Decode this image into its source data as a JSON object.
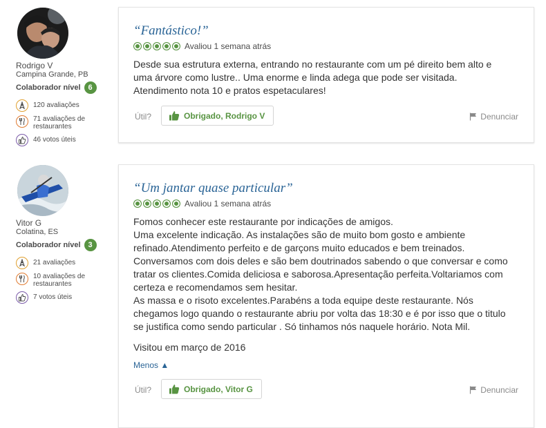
{
  "reviews": [
    {
      "member": {
        "username": "Rodrigo V",
        "location": "Campina Grande, PB",
        "level_label": "Colaborador nível",
        "level": "6",
        "stats": {
          "reviews": "120 avaliações",
          "restaurant_reviews_line1": "71 avaliações de",
          "restaurant_reviews_line2": "restaurantes",
          "helpful_votes": "46 votos úteis"
        }
      },
      "title": "“Fantástico!”",
      "rating": 5,
      "rating_date": "Avaliou 1 semana atrás",
      "body_lines": [
        "Desde sua estrutura externa, entrando no restaurante com um pé direito bem alto e",
        "uma árvore como lustre.. Uma enorme e linda adega que pode ser visitada.",
        "Atendimento nota 10 e pratos espetaculares!"
      ],
      "helpful_label": "Útil?",
      "thanks_button": "Obrigado, Rodrigo V",
      "report_label": "Denunciar"
    },
    {
      "member": {
        "username": "Vitor G",
        "location": "Colatina, ES",
        "level_label": "Colaborador nível",
        "level": "3",
        "stats": {
          "reviews": "21 avaliações",
          "restaurant_reviews_line1": "10 avaliações de",
          "restaurant_reviews_line2": "restaurantes",
          "helpful_votes": "7 votos úteis"
        }
      },
      "title": "“Um jantar quase particular”",
      "rating": 5,
      "rating_date": "Avaliou 1 semana atrás",
      "body_lines": [
        "Fomos conhecer este restaurante por indicações de amigos.",
        "Uma excelente indicação. As instalações são de muito bom gosto e ambiente",
        "refinado.Atendimento perfeito e de garçons muito educados e bem treinados.",
        "Conversamos com dois deles e são bem doutrinados sabendo o que conversar e como",
        "tratar os clientes.Comida deliciosa e saborosa.Apresentação perfeita.Voltariamos com",
        "certeza e recomendamos sem hesitar.",
        "As massa e o risoto excelentes.Parabéns a toda equipe deste restaurante. Nós",
        "chegamos logo quando o restaurante abriu por volta das 18:30 e é por isso que o titulo",
        "se justifica como sendo particular . Só tinhamos nós naquele horário. Nota Mil."
      ],
      "visit_date": "Visitou em março de 2016",
      "less_link": "Menos ▲",
      "helpful_label": "Útil?",
      "thanks_button": "Obrigado, Vitor G",
      "report_label": "Denunciar"
    }
  ],
  "colors": {
    "accent_green": "#589442",
    "link_blue": "#2a6496"
  },
  "icons": [
    "reviewer-badge-icon",
    "fork-knife-icon",
    "thumbs-up-icon",
    "flag-icon",
    "rating-bubble-icon"
  ]
}
